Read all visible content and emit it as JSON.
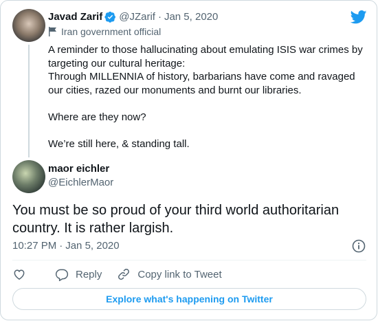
{
  "colors": {
    "brand": "#1d9bf0",
    "text": "#0f1419",
    "muted": "#536471",
    "border": "#cfd9de"
  },
  "icons": [
    "twitter-bird-icon",
    "verified-badge-icon",
    "flag-icon",
    "info-icon",
    "heart-icon",
    "reply-icon",
    "link-icon"
  ],
  "original_tweet": {
    "author_name": "Javad Zarif",
    "handle": "@JZarif",
    "date": "Jan 5, 2020",
    "separator": "·",
    "label": "Iran government official",
    "text": "A reminder to those hallucinating about emulating ISIS war crimes by targeting our cultural heritage:\nThrough MILLENNIA of history, barbarians have come and ravaged our cities, razed our monuments and burnt our libraries.\n\nWhere are they now?\n\nWe’re still here, & standing tall."
  },
  "reply_tweet": {
    "author_name": "maor eichler",
    "handle": "@EichlerMaor",
    "text": "You must be so proud of your third world authoritarian country. It is rather largish.",
    "time": "10:27 PM",
    "separator": "·",
    "date": "Jan 5, 2020"
  },
  "actions": {
    "reply_label": "Reply",
    "copy_link_label": "Copy link to Tweet"
  },
  "explore_label": "Explore what's happening on Twitter"
}
